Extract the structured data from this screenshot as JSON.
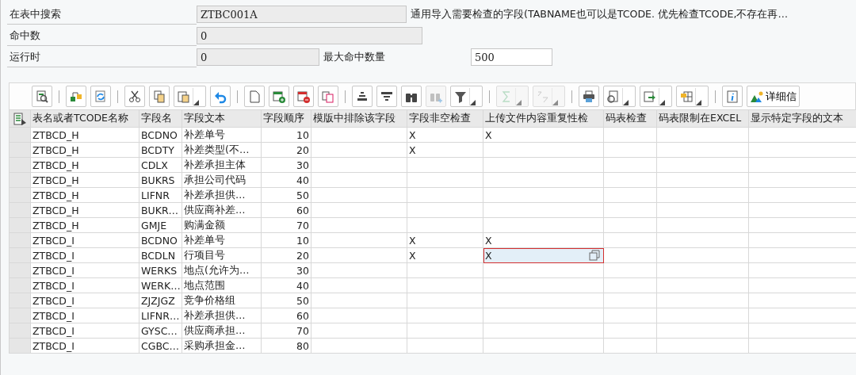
{
  "form": {
    "rows": [
      {
        "label": "在表中搜索",
        "value": "ZTBC001A",
        "note": "通用导入需要检查的字段(TABNAME也可以是TCODE. 优先检查TCODE,不存在再…"
      },
      {
        "label": "命中数",
        "value": "0"
      },
      {
        "label": "运行时",
        "value": "0",
        "extra_label": "最大命中数量",
        "extra_value": "500"
      }
    ]
  },
  "toolbar": {
    "groups": [
      [
        {
          "menu": false,
          "disabled": false
        }
      ],
      [
        {
          "menu": false,
          "disabled": false
        },
        {
          "menu": false,
          "disabled": false
        }
      ],
      [
        {
          "menu": false,
          "disabled": false
        },
        {
          "menu": false,
          "disabled": false
        },
        {
          "menu": true,
          "disabled": false
        },
        {
          "menu": false,
          "disabled": false
        }
      ],
      [
        {
          "menu": false,
          "disabled": false
        },
        {
          "menu": false,
          "disabled": false
        },
        {
          "menu": false,
          "disabled": false
        },
        {
          "menu": false,
          "disabled": false
        }
      ],
      [
        {
          "menu": false,
          "disabled": false
        },
        {
          "menu": false,
          "disabled": false
        },
        {
          "menu": false,
          "disabled": false
        },
        {
          "menu": false,
          "disabled": true
        },
        {
          "menu": true,
          "disabled": false
        }
      ],
      [
        {
          "menu": true,
          "disabled": true
        },
        {
          "menu": true,
          "disabled": true
        }
      ],
      [
        {
          "menu": false,
          "disabled": false
        },
        {
          "menu": true,
          "disabled": false
        },
        {
          "menu": true,
          "disabled": false
        },
        {
          "menu": true,
          "disabled": false
        }
      ],
      [
        {
          "menu": false,
          "disabled": false
        },
        {
          "menu": false,
          "disabled": false,
          "label": "详细信"
        }
      ]
    ]
  },
  "table": {
    "columns": [
      "表名或者TCODE名称",
      "字段名",
      "字段文本",
      "字段顺序",
      "模版中排除该字段",
      "字段非空检查",
      "上传文件内容重复性检",
      "码表检查",
      "码表限制在EXCEL",
      "显示特定字段的文本"
    ],
    "rows": [
      {
        "table": "ZTBCD_H",
        "field": "BCDNO",
        "text": "补差单号",
        "order": "10",
        "not_null": "X",
        "dup_check": "X",
        "dup_check_selected": false
      },
      {
        "table": "ZTBCD_H",
        "field": "BCDTY",
        "text": "补差类型(不…",
        "order": "20",
        "not_null": "X",
        "dup_check_selected": false
      },
      {
        "table": "ZTBCD_H",
        "field": "CDLX",
        "text": "补差承担主体",
        "order": "30",
        "dup_check_selected": false
      },
      {
        "table": "ZTBCD_H",
        "field": "BUKRS",
        "text": "承担公司代码",
        "order": "40",
        "dup_check_selected": false
      },
      {
        "table": "ZTBCD_H",
        "field": "LIFNR",
        "text": "补差承担供…",
        "order": "50",
        "dup_check_selected": false
      },
      {
        "table": "ZTBCD_H",
        "field": "BUKR…",
        "text": "供应商补差…",
        "order": "60",
        "dup_check_selected": false
      },
      {
        "table": "ZTBCD_H",
        "field": "GMJE",
        "text": "购满金额",
        "order": "70",
        "dup_check_selected": false
      },
      {
        "table": "ZTBCD_I",
        "field": "BCDNO",
        "text": "补差单号",
        "order": "10",
        "not_null": "X",
        "dup_check": "X",
        "dup_check_selected": false
      },
      {
        "table": "ZTBCD_I",
        "field": "BCDLN",
        "text": "行项目号",
        "order": "20",
        "not_null": "X",
        "dup_check": "X",
        "dup_check_selected": true
      },
      {
        "table": "ZTBCD_I",
        "field": "WERKS",
        "text": "地点(允许为…",
        "order": "30",
        "dup_check_selected": false
      },
      {
        "table": "ZTBCD_I",
        "field": "WERK…",
        "text": "地点范围",
        "order": "40",
        "dup_check_selected": false
      },
      {
        "table": "ZTBCD_I",
        "field": "ZJZJGZ",
        "text": "竞争价格组",
        "order": "50",
        "dup_check_selected": false
      },
      {
        "table": "ZTBCD_I",
        "field": "LIFNR…",
        "text": "补差承担供…",
        "order": "60",
        "dup_check_selected": false
      },
      {
        "table": "ZTBCD_I",
        "field": "GYSC…",
        "text": "供应商承担…",
        "order": "70",
        "dup_check_selected": false
      },
      {
        "table": "ZTBCD_I",
        "field": "CGBC…",
        "text": "采购承担金…",
        "order": "80",
        "dup_check_selected": false
      }
    ]
  }
}
